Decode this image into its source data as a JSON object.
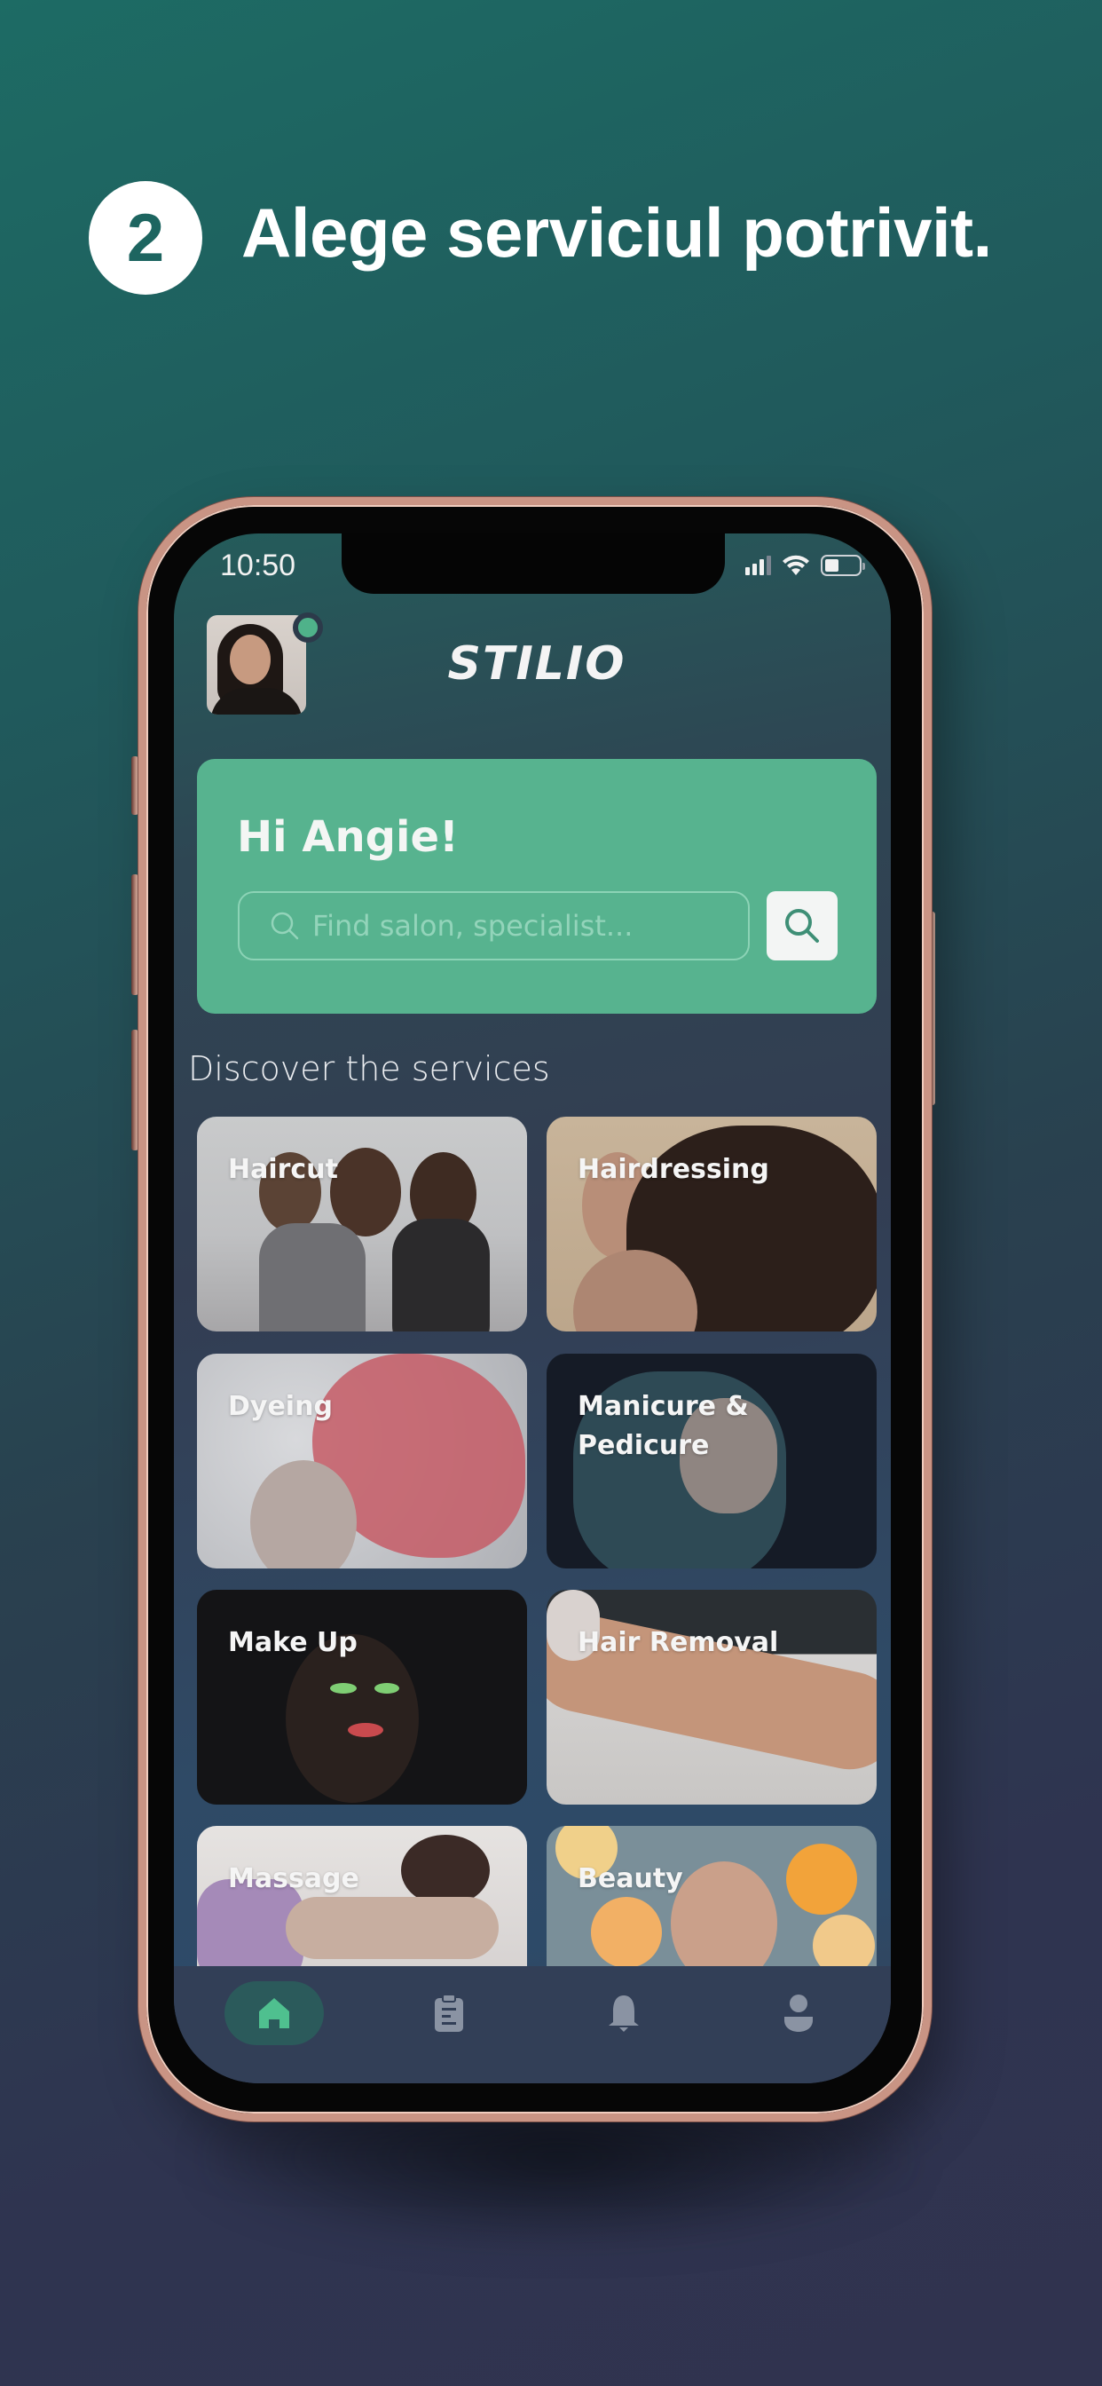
{
  "promo": {
    "step_number": "2",
    "headline": "Alege serviciul potrivit."
  },
  "status_bar": {
    "time": "10:50",
    "signal_bars_active": 3,
    "signal_bars_total": 4,
    "battery_level": 0.35
  },
  "app": {
    "logo": "STILIO",
    "avatar": {
      "online": true,
      "status_color": "#4fb28a"
    },
    "hero": {
      "greeting": "Hi Angie!",
      "search_placeholder": "Find salon, specialist..."
    },
    "section_title": "Discover the services",
    "services": [
      {
        "label": "Haircut"
      },
      {
        "label": "Hairdressing"
      },
      {
        "label": "Dyeing"
      },
      {
        "label": "Manicure & Pedicure"
      },
      {
        "label": "Make Up"
      },
      {
        "label": "Hair Removal"
      },
      {
        "label": "Massage"
      },
      {
        "label": "Beauty"
      }
    ],
    "bottom_nav": [
      {
        "name": "home",
        "icon": "home-icon",
        "active": true
      },
      {
        "name": "appointments",
        "icon": "clipboard-icon",
        "active": false
      },
      {
        "name": "notifications",
        "icon": "bell-icon",
        "active": false
      },
      {
        "name": "profile",
        "icon": "user-icon",
        "active": false
      }
    ]
  },
  "colors": {
    "accent_green": "#57b38f",
    "active_nav_icon": "#4fc08f",
    "inactive_nav_icon": "#8a93a3",
    "frame_rose_gold": "#c99484"
  }
}
